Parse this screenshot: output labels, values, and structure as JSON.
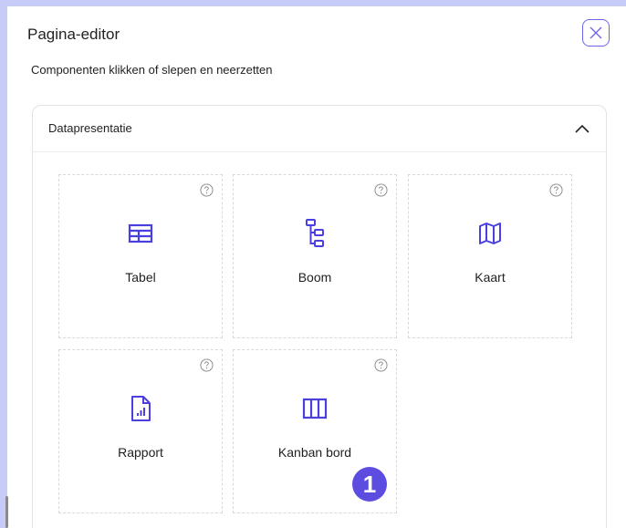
{
  "header": {
    "title": "Pagina-editor"
  },
  "instructions": "Componenten klikken of slepen en neerzetten",
  "section": {
    "title": "Datapresentatie",
    "components": [
      {
        "label": "Tabel",
        "icon": "table-icon"
      },
      {
        "label": "Boom",
        "icon": "tree-icon"
      },
      {
        "label": "Kaart",
        "icon": "map-icon"
      },
      {
        "label": "Rapport",
        "icon": "report-icon"
      },
      {
        "label": "Kanban bord",
        "icon": "kanban-icon"
      }
    ]
  },
  "badge": {
    "text": "1"
  },
  "colors": {
    "accent": "#6b63ea",
    "badge": "#5c4de0",
    "frame": "#c6cbf7"
  }
}
